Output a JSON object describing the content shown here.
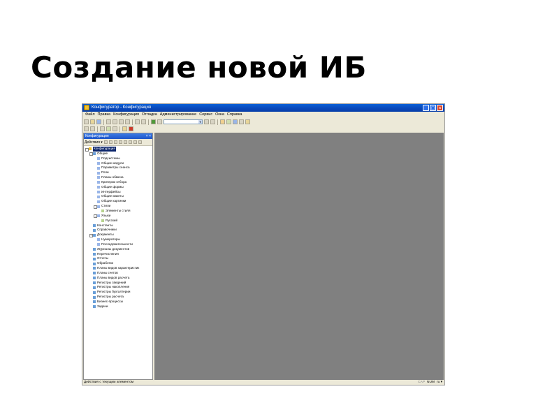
{
  "slide": {
    "title": "Создание новой ИБ"
  },
  "window": {
    "title": "Конфигуратор - Конфигурация",
    "controls": [
      "_",
      "□",
      "×"
    ]
  },
  "menu": [
    "Файл",
    "Правка",
    "Конфигурация",
    "Отладка",
    "Администрирование",
    "Сервис",
    "Окна",
    "Справка"
  ],
  "toolbar": {
    "search_value": "",
    "icons": [
      "new-icon",
      "open-icon",
      "save-icon",
      "cut-icon",
      "copy-icon",
      "paste-icon",
      "undo-icon",
      "redo-icon",
      "find-icon",
      "search-combo",
      "run-icon",
      "stop-icon"
    ]
  },
  "panel": {
    "title": "Конфигурация",
    "close": "× ×",
    "actions_label": "Действия ▾"
  },
  "tree": [
    {
      "label": "Конфигурация",
      "level": 0,
      "pm": "−",
      "selected": true
    },
    {
      "label": "Общие",
      "level": 1,
      "pm": "−"
    },
    {
      "label": "Подсистемы",
      "level": 2
    },
    {
      "label": "Общие модули",
      "level": 2
    },
    {
      "label": "Параметры сеанса",
      "level": 2
    },
    {
      "label": "Роли",
      "level": 2
    },
    {
      "label": "Планы обмена",
      "level": 2
    },
    {
      "label": "Критерии отбора",
      "level": 2
    },
    {
      "label": "Общие формы",
      "level": 2
    },
    {
      "label": "Интерфейсы",
      "level": 2
    },
    {
      "label": "Общие макеты",
      "level": 2
    },
    {
      "label": "Общие картинки",
      "level": 2
    },
    {
      "label": "Стили",
      "level": 2,
      "pm": "−"
    },
    {
      "label": "Элементы стиля",
      "level": 3
    },
    {
      "label": "Языки",
      "level": 2,
      "pm": "−"
    },
    {
      "label": "Русский",
      "level": 3
    },
    {
      "label": "Константы",
      "level": 1
    },
    {
      "label": "Справочники",
      "level": 1
    },
    {
      "label": "Документы",
      "level": 1,
      "pm": "−"
    },
    {
      "label": "Нумераторы",
      "level": 2
    },
    {
      "label": "Последовательности",
      "level": 2
    },
    {
      "label": "Журналы документов",
      "level": 1
    },
    {
      "label": "Перечисления",
      "level": 1
    },
    {
      "label": "Отчеты",
      "level": 1
    },
    {
      "label": "Обработки",
      "level": 1
    },
    {
      "label": "Планы видов характеристик",
      "level": 1
    },
    {
      "label": "Планы счетов",
      "level": 1
    },
    {
      "label": "Планы видов расчета",
      "level": 1
    },
    {
      "label": "Регистры сведений",
      "level": 1
    },
    {
      "label": "Регистры накопления",
      "level": 1
    },
    {
      "label": "Регистры бухгалтерии",
      "level": 1
    },
    {
      "label": "Регистры расчета",
      "level": 1
    },
    {
      "label": "Бизнес-процессы",
      "level": 1
    },
    {
      "label": "Задачи",
      "level": 1
    }
  ],
  "status": {
    "text": "Действия с текущим элементом",
    "cap": "CAP",
    "num": "NUM",
    "extra": "ru ▾"
  },
  "colors": {
    "titlebar": "#0846b8",
    "chrome": "#ece9d8",
    "workspace": "#808080",
    "selection": "#0a246a"
  }
}
